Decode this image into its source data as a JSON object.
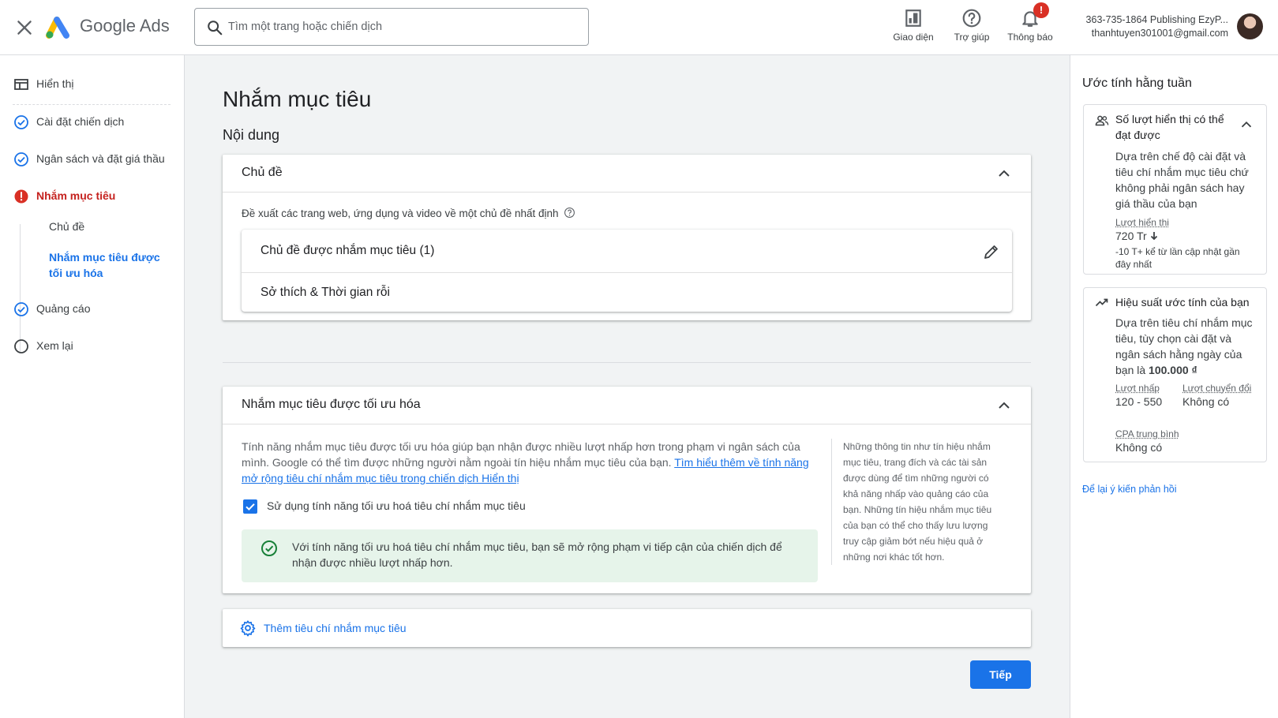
{
  "header": {
    "product_name": "Google Ads",
    "search_placeholder": "Tìm một trang hoặc chiến dịch",
    "buttons": [
      {
        "label": "Giao diện",
        "icon": "appearance-icon"
      },
      {
        "label": "Trợ giúp",
        "icon": "help-icon"
      },
      {
        "label": "Thông báo",
        "icon": "bell-icon",
        "badge": "!"
      }
    ],
    "account_name": "363-735-1864 Publishing EzyP...",
    "account_email": "thanhtuyen301001@gmail.com"
  },
  "sidebar": {
    "items": [
      {
        "label": "Hiển thị",
        "icon": "display-icon",
        "state": "none"
      },
      {
        "label": "Cài đặt chiến dịch",
        "icon": "check-circle-icon",
        "state": "done"
      },
      {
        "label": "Ngân sách và đặt giá thầu",
        "icon": "check-circle-icon",
        "state": "done"
      },
      {
        "label": "Nhắm mục tiêu",
        "icon": "error-icon",
        "state": "error"
      },
      {
        "label": "Quảng cáo",
        "icon": "check-circle-icon",
        "state": "done"
      },
      {
        "label": "Xem lại",
        "icon": "empty-circle-icon",
        "state": "todo"
      }
    ],
    "sub_items": [
      {
        "label": "Chủ đề"
      },
      {
        "label": "Nhắm mục tiêu được tối ưu hóa"
      }
    ]
  },
  "main": {
    "page_title": "Nhắm mục tiêu",
    "section_title": "Nội dung",
    "topics_card": {
      "title": "Chủ đề",
      "description": "Đề xuất các trang web, ứng dụng và video về một chủ đề nhất định",
      "targeted_label": "Chủ đề được nhắm mục tiêu (1)",
      "topic_item": "Sở thích & Thời gian rỗi"
    },
    "optimized_card": {
      "title": "Nhắm mục tiêu được tối ưu hóa",
      "text": "Tính năng nhắm mục tiêu được tối ưu hóa giúp bạn nhận được nhiều lượt nhấp hơn trong phạm vi ngân sách của mình. Google có thể tìm được những người nằm ngoài tín hiệu nhắm mục tiêu của bạn.",
      "link": "Tìm hiểu thêm về tính năng mở rộng tiêu chí nhắm mục tiêu trong chiến dịch Hiển thị",
      "checkbox_label": "Sử dụng tính năng tối ưu hoá tiêu chí nhắm mục tiêu",
      "checkbox_checked": true,
      "info_text": "Với tính năng tối ưu hoá tiêu chí nhắm mục tiêu, bạn sẽ mở rộng phạm vi tiếp cận của chiến dịch để nhận được nhiều lượt nhấp hơn.",
      "side_note": "Những thông tin như tín hiệu nhắm mục tiêu, trang đích và các tài sản được dùng để tìm những người có khả năng nhấp vào quảng cáo của bạn. Những tín hiệu nhắm mục tiêu của bạn có thể cho thấy lưu lượng truy cập giảm bớt nếu hiệu quả ở những nơi khác tốt hơn."
    },
    "add_targeting_label": "Thêm tiêu chí nhắm mục tiêu",
    "next_button": "Tiếp"
  },
  "right_panel": {
    "title": "Ước tính hằng tuần",
    "impressions_card": {
      "title": "Số lượt hiển thị có thể đạt được",
      "description": "Dựa trên chế độ cài đặt và tiêu chí nhắm mục tiêu chứ không phải ngân sách hay giá thầu của bạn",
      "metric_label": "Lượt hiển thị",
      "metric_value": "720 Tr",
      "metric_change": "-10 T+ kể từ lần cập nhật gần đây nhất"
    },
    "performance_card": {
      "title": "Hiệu suất ước tính của bạn",
      "description": "Dựa trên tiêu chí nhắm mục tiêu, tùy chọn cài đặt và ngân sách hằng ngày của bạn là",
      "budget": "100.000 ₫",
      "clicks_label": "Lượt nhấp",
      "clicks_value": "120 - 550",
      "conversions_label": "Lượt chuyển đổi",
      "conversions_value": "Không có",
      "cpa_label": "CPA trung bình",
      "cpa_value": "Không có"
    },
    "feedback_link": "Để lại ý kiến phản hồi"
  },
  "colors": {
    "accent": "#1a73e8",
    "error": "#d93025",
    "success_bg": "#e6f4ea",
    "success": "#188038"
  }
}
